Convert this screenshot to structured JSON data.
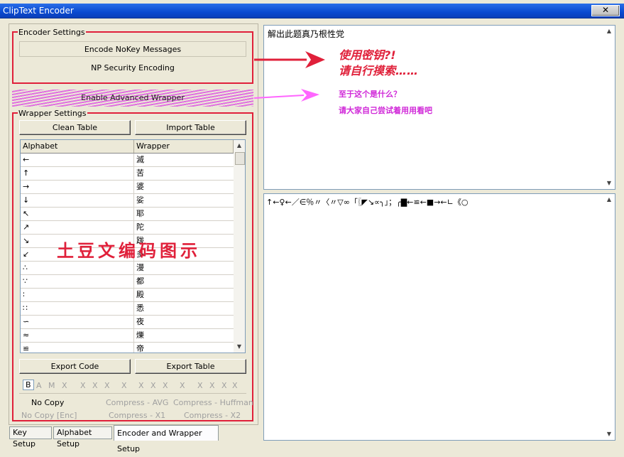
{
  "window": {
    "title": "ClipText Encoder",
    "close_label": "✕"
  },
  "encoder_settings": {
    "legend": "Encoder Settings",
    "encode_nokey": "Encode NoKey Messages",
    "np_security": "NP Security Encoding"
  },
  "advanced": {
    "label": "Enable Advanced Wrapper"
  },
  "wrapper_settings": {
    "legend": "Wrapper Settings",
    "clean_table": "Clean Table",
    "import_table": "Import Table",
    "export_code": "Export Code",
    "export_table": "Export Table",
    "columns": [
      "Alphabet",
      "Wrapper"
    ],
    "rows": [
      [
        "←",
        "滅"
      ],
      [
        "↑",
        "苦"
      ],
      [
        "→",
        "婆"
      ],
      [
        "↓",
        "娑"
      ],
      [
        "↖",
        "耶"
      ],
      [
        "↗",
        "陀"
      ],
      [
        "↘",
        "跋"
      ],
      [
        "↙",
        "多"
      ],
      [
        "∴",
        "漫"
      ],
      [
        "∵",
        "都"
      ],
      [
        "∶",
        "殿"
      ],
      [
        "∷",
        "悉"
      ],
      [
        "∽",
        "夜"
      ],
      [
        "≈",
        "爍"
      ],
      [
        "≌",
        "帝"
      ]
    ],
    "selector": [
      "B",
      "A",
      "M",
      "X",
      "X",
      "X",
      "X",
      "X",
      "X",
      "X",
      "X",
      "X",
      "X",
      "X",
      "X",
      "X"
    ],
    "no_copy": "No Copy",
    "compress_avg": "Compress - AVG",
    "compress_huffman": "Compress - Huffman",
    "no_copy_enc": "No Copy [Enc]",
    "compress_x1": "Compress - X1",
    "compress_x2": "Compress - X2"
  },
  "input_text": "解出此题真乃根性党",
  "output_text": "↑←♀←／∈％〃〈〃▽∞「〖◤↘∝╮」；╭▇←≌←■→←∟《○",
  "tabs": [
    "Key Setup",
    "Alphabet Setup",
    "Encoder and Wrapper Setup"
  ],
  "annotations": {
    "red_line1": "使用密钥?!",
    "red_line2": "请自行摸索……",
    "pink_line1": "至于这个是什么？",
    "pink_line2": "请大家自己尝试着用用看吧",
    "overlay": "土豆文编码图示"
  },
  "colors": {
    "red": "#e0203a",
    "pink": "#d028d8",
    "title_blue": "#0a4ad0"
  }
}
